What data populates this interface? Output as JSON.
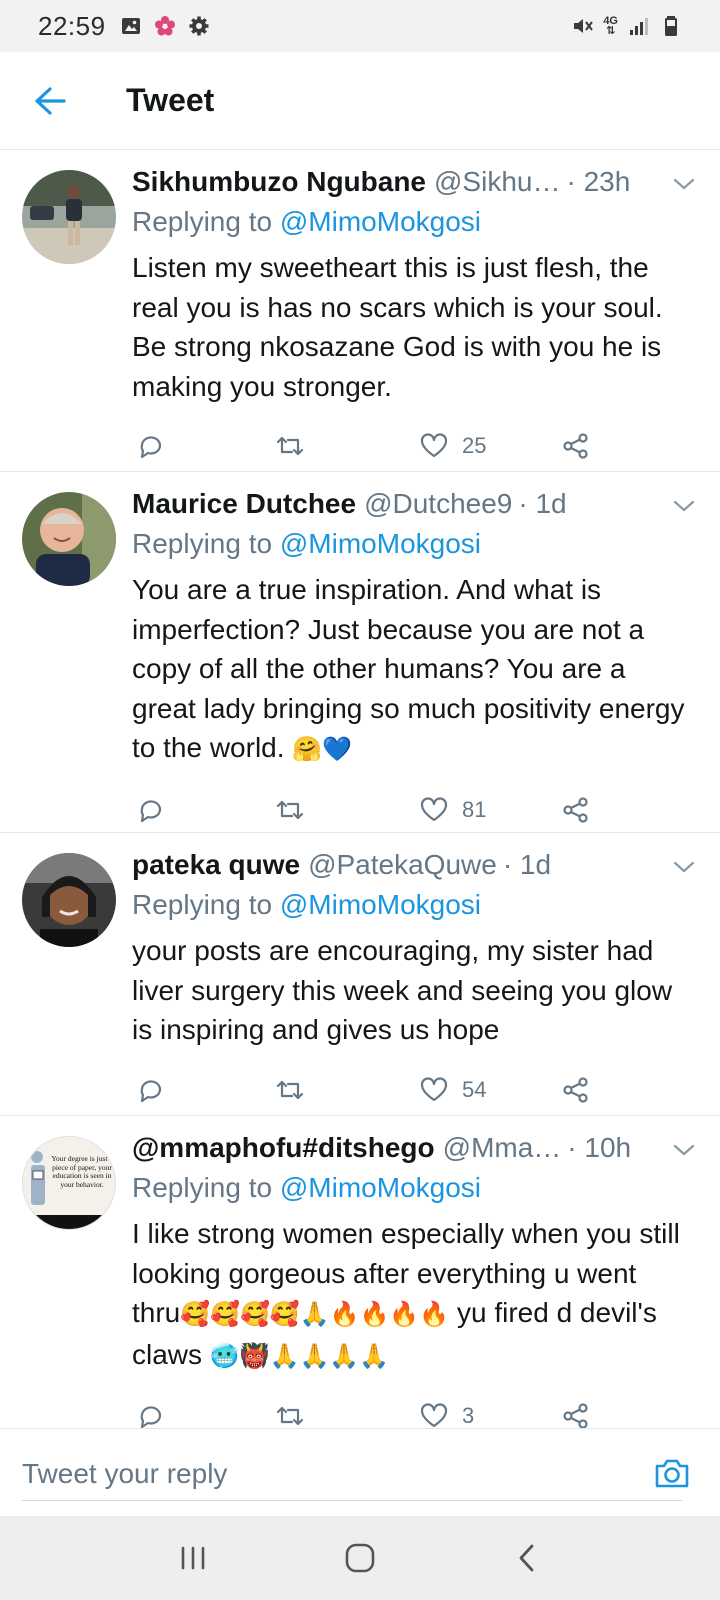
{
  "status_bar": {
    "time": "22:59",
    "network_label": "4G"
  },
  "header": {
    "title": "Tweet"
  },
  "colors": {
    "accent": "#1b95e0",
    "secondary_text": "#657786",
    "divider": "#e1e8ed"
  },
  "tweets": [
    {
      "name": "Sikhumbuzo Ngubane",
      "handle": "@Sikhu…",
      "time": "· 23h",
      "replying_prefix": "Replying to",
      "replying_to": "@MimoMokgosi",
      "text": "Listen my sweetheart this is just flesh, the real you is has no scars which is your soul. Be strong nkosazane God is with you he is making you stronger.",
      "likes": "25"
    },
    {
      "name": "Maurice Dutchee",
      "handle": "@Dutchee9",
      "time": "· 1d",
      "replying_prefix": "Replying to",
      "replying_to": "@MimoMokgosi",
      "text": "You are a true inspiration. And what is imperfection? Just because you are not a copy of all the other humans? You are a great lady bringing so much positivity energy to the world.",
      "emoji": "🤗💙",
      "likes": "81"
    },
    {
      "name": "pateka quwe",
      "handle": "@PatekaQuwe",
      "time": "· 1d",
      "replying_prefix": "Replying to",
      "replying_to": "@MimoMokgosi",
      "text": "your posts are encouraging, my sister had liver surgery this week and seeing you glow is inspiring and gives us hope",
      "likes": "54"
    },
    {
      "name": "@mmaphofu#ditshego",
      "handle": "@Mma…",
      "time": "· 10h",
      "replying_prefix": "Replying to",
      "replying_to": "@MimoMokgosi",
      "text_part1": "I like strong women especially when you still looking gorgeous after everything u went thru",
      "emoji1": "🥰🥰🥰🥰🙏🔥🔥🔥🔥",
      "text_part2": " yu fired d devil's claws ",
      "emoji2": "🥶👹🙏🙏🙏🙏",
      "likes": "3",
      "avatar_text": "Your degree is just a piece of paper, your education is seen in your behavior."
    }
  ],
  "reply_bar": {
    "placeholder": "Tweet your reply"
  }
}
